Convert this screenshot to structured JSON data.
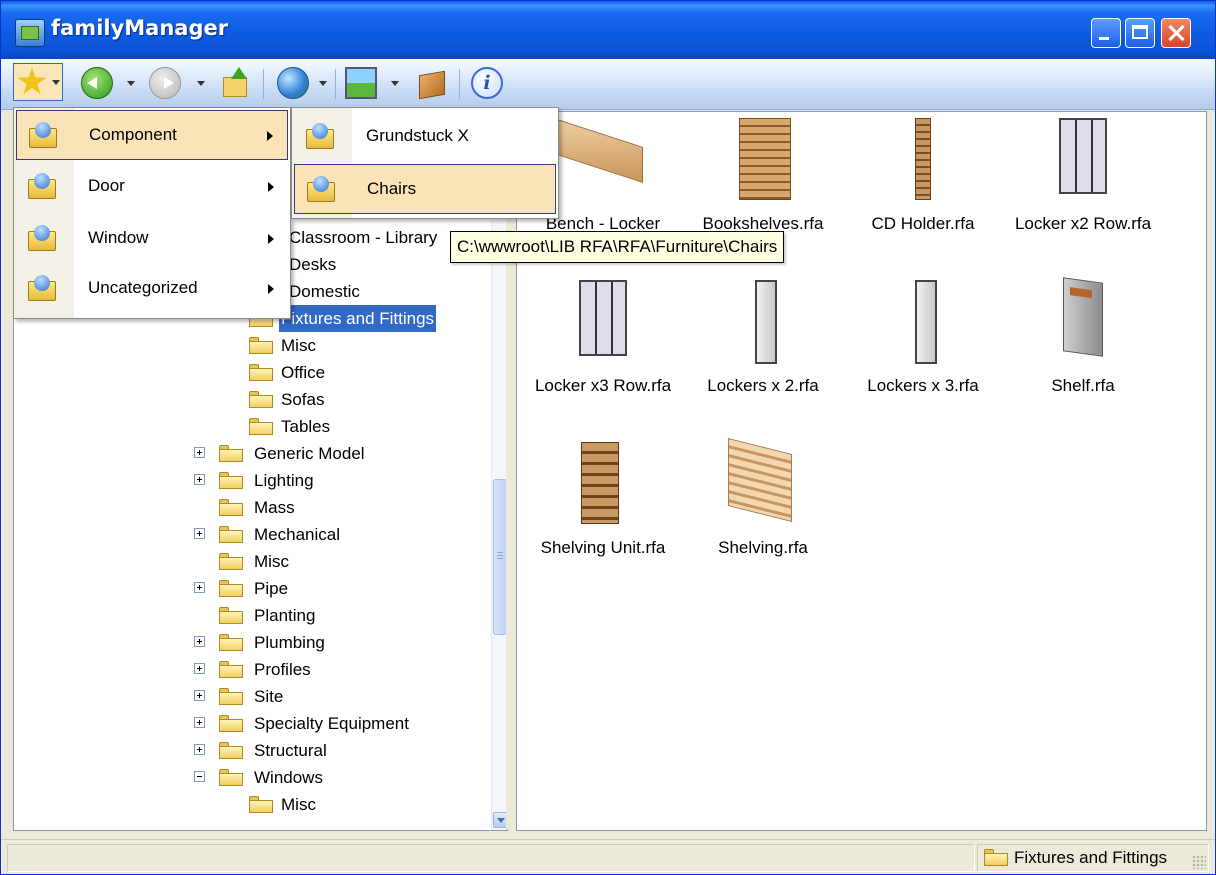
{
  "window": {
    "title": "familyManager"
  },
  "toolbar": {
    "icons": [
      "star-icon",
      "back-arrow-icon",
      "forward-arrow-icon",
      "up-folder-icon",
      "globe-icon",
      "picture-icon",
      "package-icon",
      "info-icon"
    ]
  },
  "tree": {
    "partial_items": [
      "Classroom - Library",
      "Desks",
      "Domestic"
    ],
    "items": [
      {
        "label": "Fixtures and Fittings",
        "selected": true
      },
      {
        "label": "Misc"
      },
      {
        "label": "Office"
      },
      {
        "label": "Sofas"
      },
      {
        "label": "Tables"
      },
      {
        "label": "Generic Model",
        "expander": "+"
      },
      {
        "label": "Lighting",
        "expander": "+"
      },
      {
        "label": "Mass"
      },
      {
        "label": "Mechanical",
        "expander": "+"
      },
      {
        "label": "Misc"
      },
      {
        "label": "Pipe",
        "expander": "+"
      },
      {
        "label": "Planting"
      },
      {
        "label": "Plumbing",
        "expander": "+"
      },
      {
        "label": "Profiles",
        "expander": "+"
      },
      {
        "label": "Site",
        "expander": "+"
      },
      {
        "label": "Specialty Equipment",
        "expander": "+"
      },
      {
        "label": "Structural",
        "expander": "+"
      },
      {
        "label": "Windows",
        "expander": "-"
      },
      {
        "label": "Misc"
      }
    ]
  },
  "files": [
    {
      "label": "Bench - Locker",
      "thumb": "bench"
    },
    {
      "label": "Bookshelves.rfa",
      "thumb": "bookshelves"
    },
    {
      "label": "CD Holder.rfa",
      "thumb": "cd-holder"
    },
    {
      "label": "Locker x2 Row.rfa",
      "thumb": "locker-x2-row"
    },
    {
      "label": "Locker x3 Row.rfa",
      "thumb": "locker-x3-row"
    },
    {
      "label": "Lockers x 2.rfa",
      "thumb": "lockers-x2"
    },
    {
      "label": "Lockers x 3.rfa",
      "thumb": "lockers-x3"
    },
    {
      "label": "Shelf.rfa",
      "thumb": "shelf"
    },
    {
      "label": "Shelving Unit.rfa",
      "thumb": "shelving-unit"
    },
    {
      "label": "Shelving.rfa",
      "thumb": "shelving"
    }
  ],
  "menu": {
    "items": [
      {
        "label": "Component",
        "has_submenu": true,
        "highlighted": true
      },
      {
        "label": "Door",
        "has_submenu": true
      },
      {
        "label": "Window",
        "has_submenu": true
      },
      {
        "label": "Uncategorized",
        "has_submenu": true
      }
    ]
  },
  "submenu": {
    "items": [
      {
        "label": "Grundstuck X"
      },
      {
        "label": "Chairs",
        "highlighted": true
      }
    ]
  },
  "tooltip": {
    "text": "C:\\wwwroot\\LIB RFA\\RFA\\Furniture\\Chairs"
  },
  "status": {
    "current_folder": "Fixtures and Fittings"
  },
  "colors": {
    "selection": "#316ac5",
    "menu_highlight": "#fbe3b8",
    "titlebar": "#0b53d6"
  }
}
